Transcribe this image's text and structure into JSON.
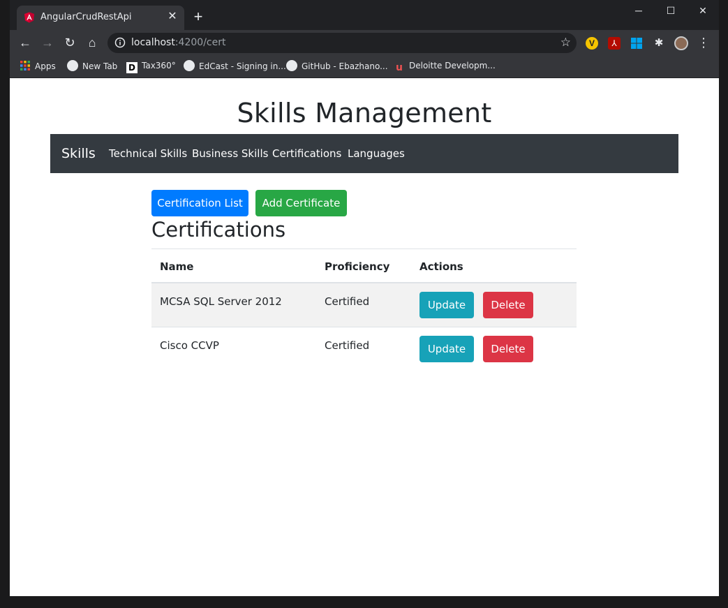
{
  "browser": {
    "tab": {
      "title": "AngularCrudRestApi",
      "favicon": "angular-icon"
    },
    "url": {
      "host": "localhost",
      "path": ":4200/cert"
    },
    "bookmarks": [
      {
        "label": "Apps",
        "icon": "apps-grid-icon"
      },
      {
        "label": "New Tab",
        "icon": "globe-icon"
      },
      {
        "label": "Tax360°",
        "icon": "deloitte-d-icon"
      },
      {
        "label": "EdCast - Signing in...",
        "icon": "globe-icon"
      },
      {
        "label": "GitHub - Ebazhano...",
        "icon": "github-icon"
      },
      {
        "label": "Deloitte Developm...",
        "icon": "udemy-icon"
      }
    ]
  },
  "page": {
    "heading": "Skills Management",
    "navbar": {
      "brand": "Skills",
      "links": [
        "Technical Skills",
        "Business Skills",
        "Certifications",
        "Languages"
      ]
    },
    "actions": {
      "list_label": "Certification List",
      "add_label": "Add Certificate"
    },
    "section_title": "Certifications",
    "table": {
      "headers": [
        "Name",
        "Proficiency",
        "Actions"
      ],
      "rows": [
        {
          "name": "MCSA SQL Server 2012",
          "proficiency": "Certified",
          "update": "Update",
          "delete": "Delete"
        },
        {
          "name": "Cisco CCVP",
          "proficiency": "Certified",
          "update": "Update",
          "delete": "Delete"
        }
      ]
    }
  },
  "colors": {
    "primary": "#007bff",
    "success": "#28a745",
    "info": "#17a2b8",
    "danger": "#dc3545",
    "navbar": "#343a40"
  }
}
